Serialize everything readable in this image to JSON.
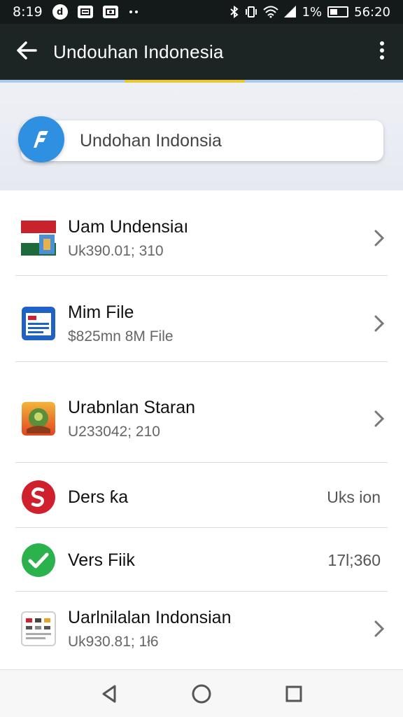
{
  "status_bar": {
    "time": "8:19",
    "battery_text": "1%",
    "clock_right": "56:20",
    "icons": [
      "notification-icon",
      "message-icon",
      "photo-icon",
      "more-dots-icon",
      "bluetooth-icon",
      "vibrate-icon",
      "wifi-icon",
      "signal-icon",
      "battery-icon"
    ]
  },
  "app_bar": {
    "title": "Undouhan Indonesia",
    "back_icon": "arrow-left-icon",
    "overflow_icon": "more-vertical-icon"
  },
  "search": {
    "value": "Undohan Indonsia",
    "icon": "app-badge-icon"
  },
  "list": {
    "items": [
      {
        "title": "Uam Undensiaı",
        "subtitle": "Uk390.01; 310",
        "icon": "flag-app-icon",
        "trailing": "chevron-right-icon"
      },
      {
        "title": "Mim File",
        "subtitle": "$825mn 8M File",
        "icon": "file-doc-icon",
        "trailing": "chevron-right-icon"
      },
      {
        "title": "Urabnlan Staran",
        "subtitle": "U233042; 210",
        "icon": "landscape-app-icon",
        "trailing": "chevron-right-icon"
      },
      {
        "title": "Ders ƙa",
        "trailing_text": "Uks ion",
        "icon": "red-s-icon"
      },
      {
        "title": "Vers Fiik",
        "trailing_text": "17l;360",
        "icon": "green-check-icon"
      },
      {
        "title": "Uarlnilalan Indonsian",
        "subtitle": "Uk930.81; 1ł6",
        "icon": "grid-doc-icon",
        "trailing": "chevron-right-icon"
      }
    ]
  },
  "nav_bar": {
    "icons": [
      "back-triangle-icon",
      "home-circle-icon",
      "recents-square-icon"
    ]
  },
  "colors": {
    "status_bar_bg": "#141a1a",
    "app_bar_bg": "#1c2424",
    "accent_blue": "#2f8fe0",
    "tab_indicator": "#e9c434",
    "red": "#d0202e",
    "green": "#2bb24c"
  }
}
